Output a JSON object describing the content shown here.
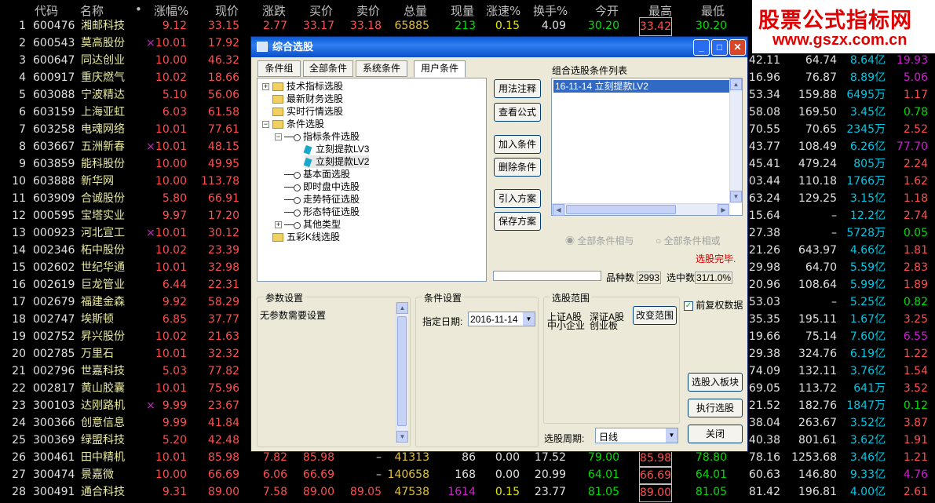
{
  "header": {
    "cols": [
      "代码",
      "名称",
      "•",
      "涨幅%",
      "现价",
      "涨跌",
      "买价",
      "卖价",
      "总量",
      "现量",
      "涨速%",
      "换手%",
      "今开",
      "最高",
      "最低"
    ]
  },
  "rows": [
    {
      "n": "1",
      "code": "600476",
      "name": "湘邮科技",
      "mark": "",
      "pct": "9.12",
      "price": "33.15",
      "chg": "2.77",
      "bid": "33.17",
      "ask": "33.18",
      "vol": "65885",
      "cur": "213",
      "spd": "0.15",
      "turn": "4.09",
      "open": "30.20",
      "high": "33.42",
      "low": "30.20",
      "c13": "",
      "c14": "",
      "c15": "",
      "c16": ""
    },
    {
      "n": "2",
      "code": "600543",
      "name": "莫高股份",
      "mark": "×",
      "pct": "10.01",
      "price": "17.92",
      "c13": "",
      "c14": "64.74",
      "c15": "8.64亿",
      "c16": "19.93"
    },
    {
      "n": "3",
      "code": "600647",
      "name": "同达创业",
      "mark": "",
      "pct": "10.00",
      "price": "46.32",
      "c13": "42.11",
      "c14": "64.74",
      "c15": "8.64亿",
      "c16": "19.93"
    },
    {
      "n": "4",
      "code": "600917",
      "name": "重庆燃气",
      "mark": "",
      "pct": "10.02",
      "price": "18.66",
      "c13": "16.96",
      "c14": "76.87",
      "c15": "8.89亿",
      "c16": "5.06"
    },
    {
      "n": "5",
      "code": "603088",
      "name": "宁波精达",
      "mark": "",
      "pct": "5.10",
      "price": "56.06",
      "c13": "53.34",
      "c14": "159.88",
      "c15": "6495万",
      "c16": "1.17"
    },
    {
      "n": "6",
      "code": "603159",
      "name": "上海亚虹",
      "mark": "",
      "pct": "6.03",
      "price": "61.58",
      "c13": "58.08",
      "c14": "169.50",
      "c15": "3.45亿",
      "c16": "0.78"
    },
    {
      "n": "7",
      "code": "603258",
      "name": "电魂网络",
      "mark": "",
      "pct": "10.01",
      "price": "77.61",
      "c13": "70.55",
      "c14": "70.65",
      "c15": "2345万",
      "c16": "2.52"
    },
    {
      "n": "8",
      "code": "603667",
      "name": "五洲新春",
      "mark": "×",
      "pct": "10.01",
      "price": "48.15",
      "c13": "43.77",
      "c14": "108.49",
      "c15": "6.26亿",
      "c16": "77.70"
    },
    {
      "n": "9",
      "code": "603859",
      "name": "能科股份",
      "mark": "",
      "pct": "10.00",
      "price": "49.95",
      "c13": "45.41",
      "c14": "479.24",
      "c15": "805万",
      "c16": "2.24"
    },
    {
      "n": "10",
      "code": "603888",
      "name": "新华网",
      "mark": "",
      "pct": "10.00",
      "price": "113.78",
      "c13": "103.44",
      "c14": "110.18",
      "c15": "1766万",
      "c16": "1.62"
    },
    {
      "n": "11",
      "code": "603909",
      "name": "合诚股份",
      "mark": "",
      "pct": "5.80",
      "price": "66.91",
      "c13": "63.24",
      "c14": "129.25",
      "c15": "3.15亿",
      "c16": "1.18"
    },
    {
      "n": "12",
      "code": "000595",
      "name": "宝塔实业",
      "mark": "",
      "pct": "9.97",
      "price": "17.20",
      "c13": "15.64",
      "c14": "–",
      "c15": "12.2亿",
      "c16": "2.74"
    },
    {
      "n": "13",
      "code": "000923",
      "name": "河北宣工",
      "mark": "×",
      "pct": "10.01",
      "price": "30.12",
      "c13": "27.38",
      "c14": "–",
      "c15": "5728万",
      "c16": "0.05"
    },
    {
      "n": "14",
      "code": "002346",
      "name": "柘中股份",
      "mark": "",
      "pct": "10.02",
      "price": "23.39",
      "c13": "21.26",
      "c14": "643.97",
      "c15": "4.66亿",
      "c16": "1.81"
    },
    {
      "n": "15",
      "code": "002602",
      "name": "世纪华通",
      "mark": "",
      "pct": "10.01",
      "price": "32.98",
      "c13": "29.98",
      "c14": "64.70",
      "c15": "5.59亿",
      "c16": "2.83"
    },
    {
      "n": "16",
      "code": "002619",
      "name": "巨龙管业",
      "mark": "",
      "pct": "6.44",
      "price": "22.31",
      "c13": "20.96",
      "c14": "108.64",
      "c15": "5.99亿",
      "c16": "1.89"
    },
    {
      "n": "17",
      "code": "002679",
      "name": "福建金森",
      "mark": "",
      "pct": "9.92",
      "price": "58.29",
      "c13": "53.03",
      "c14": "–",
      "c15": "5.25亿",
      "c16": "0.82"
    },
    {
      "n": "18",
      "code": "002747",
      "name": "埃斯顿",
      "mark": "",
      "pct": "6.85",
      "price": "37.77",
      "c13": "35.35",
      "c14": "195.11",
      "c15": "1.67亿",
      "c16": "3.25"
    },
    {
      "n": "19",
      "code": "002752",
      "name": "昇兴股份",
      "mark": "",
      "pct": "10.02",
      "price": "21.63",
      "c13": "19.66",
      "c14": "75.14",
      "c15": "7.60亿",
      "c16": "6.55"
    },
    {
      "n": "20",
      "code": "002785",
      "name": "万里石",
      "mark": "",
      "pct": "10.01",
      "price": "32.32",
      "c13": "29.38",
      "c14": "324.76",
      "c15": "6.19亿",
      "c16": "1.22"
    },
    {
      "n": "21",
      "code": "002796",
      "name": "世嘉科技",
      "mark": "",
      "pct": "5.03",
      "price": "77.82",
      "c13": "74.09",
      "c14": "132.11",
      "c15": "3.76亿",
      "c16": "1.54"
    },
    {
      "n": "22",
      "code": "002817",
      "name": "黄山胶囊",
      "mark": "",
      "pct": "10.01",
      "price": "75.96",
      "c13": "69.05",
      "c14": "113.72",
      "c15": "641万",
      "c16": "3.52"
    },
    {
      "n": "23",
      "code": "300103",
      "name": "达刚路机",
      "mark": "×",
      "pct": "9.99",
      "price": "23.67",
      "c13": "21.52",
      "c14": "182.76",
      "c15": "1847万",
      "c16": "0.12"
    },
    {
      "n": "24",
      "code": "300366",
      "name": "创意信息",
      "mark": "",
      "pct": "9.99",
      "price": "41.84",
      "c13": "38.04",
      "c14": "263.67",
      "c15": "3.52亿",
      "c16": "3.87"
    },
    {
      "n": "25",
      "code": "300369",
      "name": "绿盟科技",
      "mark": "",
      "pct": "5.20",
      "price": "42.48",
      "c13": "40.38",
      "c14": "801.61",
      "c15": "3.62亿",
      "c16": "1.91"
    },
    {
      "n": "26",
      "code": "300461",
      "name": "田中精机",
      "mark": "",
      "pct": "10.01",
      "price": "85.98",
      "chg": "7.82",
      "bid": "85.98",
      "ask": "–",
      "vol": "41313",
      "cur": "86",
      "spd": "0.00",
      "turn": "17.52",
      "open": "79.00",
      "high": "85.98",
      "low": "78.80",
      "c13": "78.16",
      "c14": "1253.68",
      "c15": "3.46亿",
      "c16": "1.21"
    },
    {
      "n": "27",
      "code": "300474",
      "name": "景嘉微",
      "mark": "",
      "pct": "10.00",
      "price": "66.69",
      "chg": "6.06",
      "bid": "66.69",
      "ask": "–",
      "vol": "140658",
      "cur": "168",
      "spd": "0.00",
      "turn": "20.99",
      "open": "64.01",
      "high": "66.69",
      "low": "64.01",
      "c13": "60.63",
      "c14": "146.80",
      "c15": "9.33亿",
      "c16": "4.76"
    },
    {
      "n": "28",
      "code": "300491",
      "name": "通合科技",
      "mark": "",
      "pct": "9.31",
      "price": "89.00",
      "chg": "7.58",
      "bid": "89.00",
      "ask": "89.05",
      "vol": "47538",
      "cur": "1614",
      "spd": "0.15",
      "turn": "23.77",
      "open": "81.05",
      "high": "89.00",
      "low": "81.05",
      "c13": "81.42",
      "c14": "196.81",
      "c15": "4.00亿",
      "c16": "2.61"
    }
  ],
  "watermark": {
    "line1": "股票公式指标网",
    "line2": "www.gszx.com.cn"
  },
  "dialog": {
    "title": "综合选股",
    "tabs": [
      "条件组",
      "全部条件",
      "系统条件",
      "用户条件"
    ],
    "tree": {
      "n1": "技术指标选股",
      "n2": "最新财务选股",
      "n3": "实时行情选股",
      "n4": "条件选股",
      "n5": "指标条件选股",
      "n6": "立刻提款LV3",
      "n7": "立刻提款LV2",
      "n8": "基本面选股",
      "n9": "即时盘中选股",
      "n10": "走势特征选股",
      "n11": "形态特征选股",
      "n12": "其他类型",
      "n13": "五彩K线选股"
    },
    "buttons": {
      "usage": "用法注释",
      "view": "查看公式",
      "add": "加入条件",
      "del": "删除条件",
      "import": "引入方案",
      "save": "保存方案",
      "toblock": "选股入板块",
      "exec": "执行选股",
      "close": "关闭",
      "range": "改变范围"
    },
    "list_title": "组合选股条件列表",
    "list_item": "16-11-14 立刻提款LV2",
    "radio_and": "全部条件相与",
    "radio_or": "全部条件相或",
    "done": "选股完毕.",
    "count_label": "品种数",
    "count": "2993",
    "hit_label": "选中数",
    "hit": "31/1.0%",
    "param_title": "参数设置",
    "param_text": "无参数需要设置",
    "cond_title": "条件设置",
    "date_label": "指定日期:",
    "date": "2016-11-14",
    "range_title": "选股范围",
    "range1": "上证A股",
    "range2": "深证A股",
    "range3": "中小企业",
    "range4": "创业板",
    "fq": "前复权数据",
    "period_label": "选股周期:",
    "period": "日线"
  }
}
